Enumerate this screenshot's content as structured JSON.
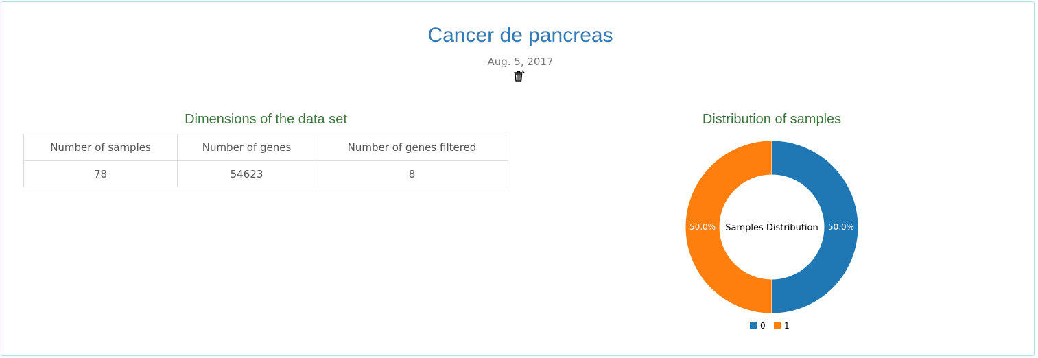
{
  "header": {
    "title": "Cancer de pancreas",
    "date": "Aug. 5, 2017",
    "delete_icon": "trash-icon"
  },
  "dimensions": {
    "heading": "Dimensions of the data set",
    "columns": [
      "Number of samples",
      "Number of genes",
      "Number of genes filtered"
    ],
    "values": [
      "78",
      "54623",
      "8"
    ]
  },
  "distribution": {
    "heading": "Distribution of samples"
  },
  "colors": {
    "title": "#337ab7",
    "section_heading": "#3c763d",
    "series_0": "#1f77b4",
    "series_1": "#ff7f0e"
  },
  "chart_data": {
    "type": "pie",
    "donut": true,
    "center_label": "Samples Distribution",
    "categories": [
      "0",
      "1"
    ],
    "values": [
      50.0,
      50.0
    ],
    "value_labels": [
      "50.0%",
      "50.0%"
    ],
    "legend_position": "bottom"
  }
}
